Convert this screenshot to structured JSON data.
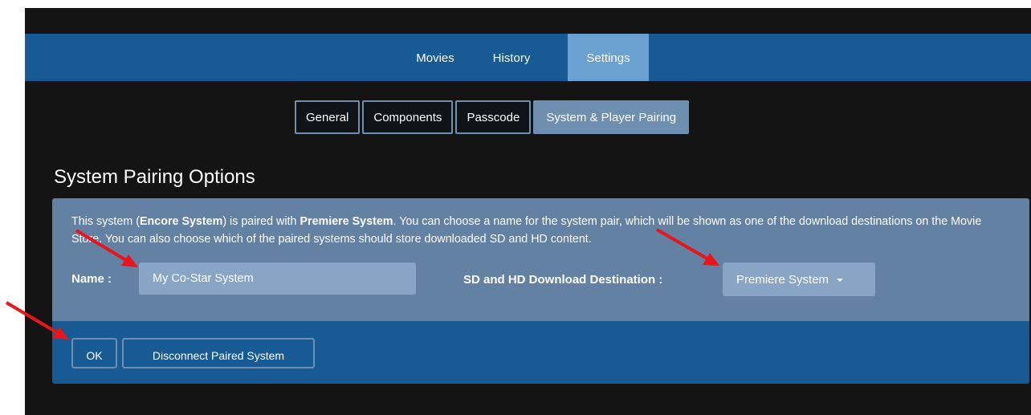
{
  "nav": {
    "tabs": [
      {
        "label": "Movies"
      },
      {
        "label": "History"
      },
      {
        "label": "Settings"
      }
    ]
  },
  "subnav": {
    "tabs": [
      {
        "label": "General"
      },
      {
        "label": "Components"
      },
      {
        "label": "Passcode"
      },
      {
        "label": "System & Player Pairing"
      }
    ]
  },
  "page": {
    "title": "System Pairing Options"
  },
  "pairing": {
    "desc_prefix": "This system (",
    "this_system": "Encore System",
    "desc_middle": ") is paired with ",
    "paired_system": "Premiere System",
    "desc_suffix": ". You can choose a name for the system pair, which will be shown as one of the download destinations on the Movie Store. You can also choose which of the paired systems should store downloaded SD and HD content.",
    "name_label": "Name :",
    "name_value": "My Co-Star System",
    "destination_label": "SD and HD Download Destination :",
    "destination_value": "Premiere System"
  },
  "actions": {
    "ok_label": "OK",
    "disconnect_label": "Disconnect Paired System"
  },
  "colors": {
    "topbar": "#175a94",
    "active_tab": "#6ba1d1",
    "panel": "#6381a3",
    "annotation_arrow": "#e8151b"
  }
}
